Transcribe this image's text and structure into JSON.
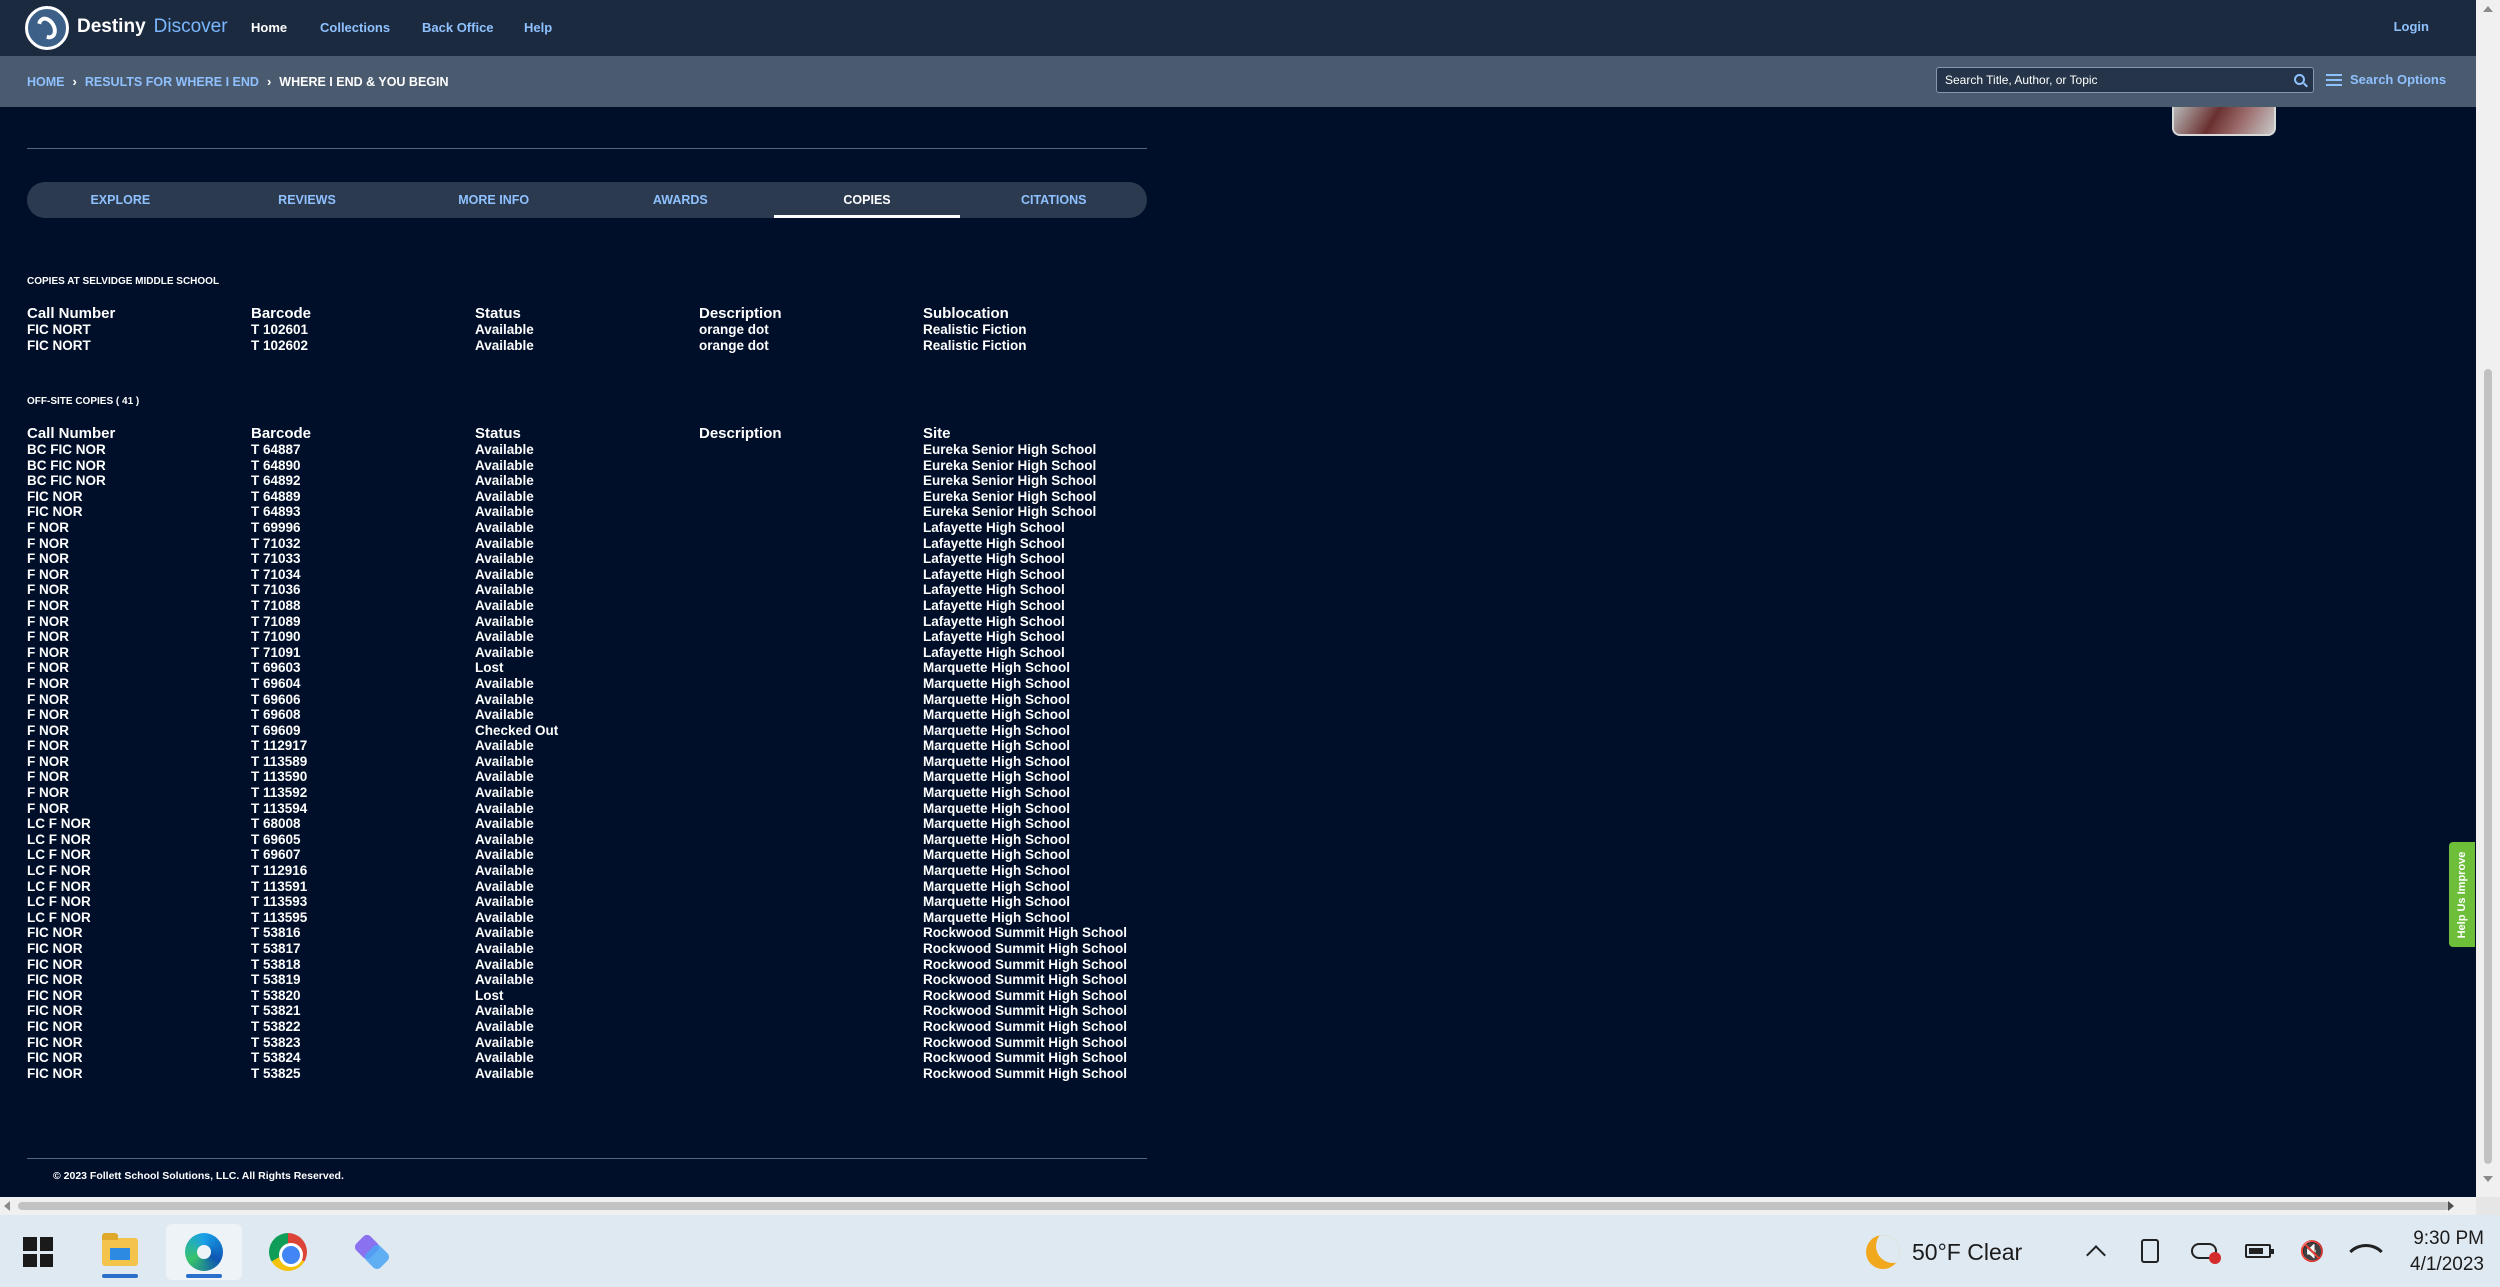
{
  "nav": {
    "brand_left": "Destiny",
    "brand_right": "Discover",
    "links": [
      "Home",
      "Collections",
      "Back Office",
      "Help"
    ],
    "login": "Login"
  },
  "breadcrumb": {
    "home": "HOME",
    "results": "RESULTS FOR WHERE I END",
    "current": "WHERE I END & YOU BEGIN",
    "sep": "›"
  },
  "search": {
    "placeholder": "Search Title, Author, or Topic",
    "options_label": "Search Options"
  },
  "tabs": [
    "EXPLORE",
    "REVIEWS",
    "MORE INFO",
    "AWARDS",
    "COPIES",
    "CITATIONS"
  ],
  "local_copies": {
    "title": "COPIES AT SELVIDGE MIDDLE SCHOOL",
    "headers": [
      "Call Number",
      "Barcode",
      "Status",
      "Description",
      "Sublocation"
    ],
    "rows": [
      [
        "FIC NORT",
        "T 102601",
        "Available",
        "orange dot",
        "Realistic Fiction"
      ],
      [
        "FIC NORT",
        "T 102602",
        "Available",
        "orange dot",
        "Realistic Fiction"
      ]
    ]
  },
  "offsite_copies": {
    "title": "OFF-SITE COPIES ( 41 )",
    "headers": [
      "Call Number",
      "Barcode",
      "Status",
      "Description",
      "Site"
    ],
    "rows": [
      [
        "BC FIC NOR",
        "T 64887",
        "Available",
        "",
        "Eureka Senior High School"
      ],
      [
        "BC FIC NOR",
        "T 64890",
        "Available",
        "",
        "Eureka Senior High School"
      ],
      [
        "BC FIC NOR",
        "T 64892",
        "Available",
        "",
        "Eureka Senior High School"
      ],
      [
        "FIC NOR",
        "T 64889",
        "Available",
        "",
        "Eureka Senior High School"
      ],
      [
        "FIC NOR",
        "T 64893",
        "Available",
        "",
        "Eureka Senior High School"
      ],
      [
        "F NOR",
        "T 69996",
        "Available",
        "",
        "Lafayette High School"
      ],
      [
        "F NOR",
        "T 71032",
        "Available",
        "",
        "Lafayette High School"
      ],
      [
        "F NOR",
        "T 71033",
        "Available",
        "",
        "Lafayette High School"
      ],
      [
        "F NOR",
        "T 71034",
        "Available",
        "",
        "Lafayette High School"
      ],
      [
        "F NOR",
        "T 71036",
        "Available",
        "",
        "Lafayette High School"
      ],
      [
        "F NOR",
        "T 71088",
        "Available",
        "",
        "Lafayette High School"
      ],
      [
        "F NOR",
        "T 71089",
        "Available",
        "",
        "Lafayette High School"
      ],
      [
        "F NOR",
        "T 71090",
        "Available",
        "",
        "Lafayette High School"
      ],
      [
        "F NOR",
        "T 71091",
        "Available",
        "",
        "Lafayette High School"
      ],
      [
        "F NOR",
        "T 69603",
        "Lost",
        "",
        "Marquette High School"
      ],
      [
        "F NOR",
        "T 69604",
        "Available",
        "",
        "Marquette High School"
      ],
      [
        "F NOR",
        "T 69606",
        "Available",
        "",
        "Marquette High School"
      ],
      [
        "F NOR",
        "T 69608",
        "Available",
        "",
        "Marquette High School"
      ],
      [
        "F NOR",
        "T 69609",
        "Checked Out",
        "",
        "Marquette High School"
      ],
      [
        "F NOR",
        "T 112917",
        "Available",
        "",
        "Marquette High School"
      ],
      [
        "F NOR",
        "T 113589",
        "Available",
        "",
        "Marquette High School"
      ],
      [
        "F NOR",
        "T 113590",
        "Available",
        "",
        "Marquette High School"
      ],
      [
        "F NOR",
        "T 113592",
        "Available",
        "",
        "Marquette High School"
      ],
      [
        "F NOR",
        "T 113594",
        "Available",
        "",
        "Marquette High School"
      ],
      [
        "LC F NOR",
        "T 68008",
        "Available",
        "",
        "Marquette High School"
      ],
      [
        "LC F NOR",
        "T 69605",
        "Available",
        "",
        "Marquette High School"
      ],
      [
        "LC F NOR",
        "T 69607",
        "Available",
        "",
        "Marquette High School"
      ],
      [
        "LC F NOR",
        "T 112916",
        "Available",
        "",
        "Marquette High School"
      ],
      [
        "LC F NOR",
        "T 113591",
        "Available",
        "",
        "Marquette High School"
      ],
      [
        "LC F NOR",
        "T 113593",
        "Available",
        "",
        "Marquette High School"
      ],
      [
        "LC F NOR",
        "T 113595",
        "Available",
        "",
        "Marquette High School"
      ],
      [
        "FIC NOR",
        "T 53816",
        "Available",
        "",
        "Rockwood Summit High School"
      ],
      [
        "FIC NOR",
        "T 53817",
        "Available",
        "",
        "Rockwood Summit High School"
      ],
      [
        "FIC NOR",
        "T 53818",
        "Available",
        "",
        "Rockwood Summit High School"
      ],
      [
        "FIC NOR",
        "T 53819",
        "Available",
        "",
        "Rockwood Summit High School"
      ],
      [
        "FIC NOR",
        "T 53820",
        "Lost",
        "",
        "Rockwood Summit High School"
      ],
      [
        "FIC NOR",
        "T 53821",
        "Available",
        "",
        "Rockwood Summit High School"
      ],
      [
        "FIC NOR",
        "T 53822",
        "Available",
        "",
        "Rockwood Summit High School"
      ],
      [
        "FIC NOR",
        "T 53823",
        "Available",
        "",
        "Rockwood Summit High School"
      ],
      [
        "FIC NOR",
        "T 53824",
        "Available",
        "",
        "Rockwood Summit High School"
      ],
      [
        "FIC NOR",
        "T 53825",
        "Available",
        "",
        "Rockwood Summit High School"
      ]
    ]
  },
  "footer": {
    "copyright": "© 2023 Follett School Solutions, LLC. All Rights Reserved."
  },
  "help_tab": "Help Us Improve",
  "taskbar": {
    "weather": "50°F  Clear",
    "time": "9:30 PM",
    "date": "4/1/2023",
    "speaker_glyph": "🔇"
  },
  "colors": {
    "page_bg": "#000f29",
    "nav_bg": "#1c2a3f",
    "link": "#8fc1ff",
    "help_green": "#6dbf3a"
  }
}
